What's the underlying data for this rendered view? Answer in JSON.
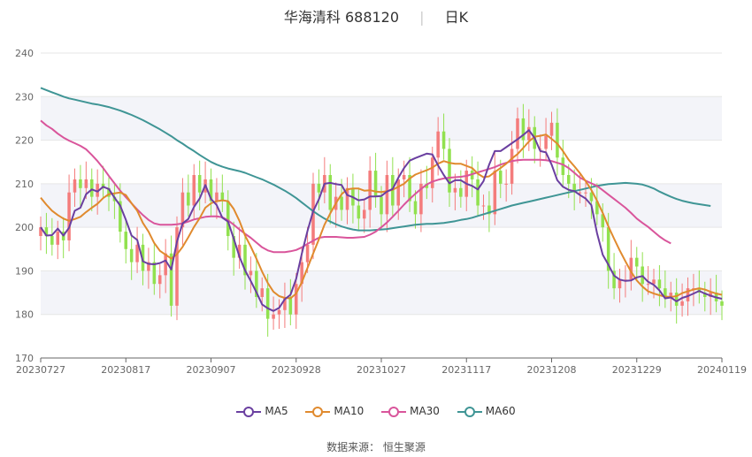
{
  "header": {
    "name_code": "华海清科 688120",
    "period": "日K"
  },
  "source": {
    "label": "数据来源：",
    "provider": "恒生聚源"
  },
  "colors": {
    "up": "#f47c7c",
    "down": "#91e14f",
    "MA5": "#6a3fa0",
    "MA10": "#e08a2e",
    "MA30": "#d9559b",
    "MA60": "#3f9595",
    "band": "#f3f4f9",
    "grid": "#e6e6e6"
  },
  "chart_data": {
    "type": "candlestick",
    "y_axis": {
      "min": 170,
      "max": 240,
      "ticks": [
        "240",
        "230",
        "220",
        "210",
        "200",
        "190",
        "180",
        "170"
      ]
    },
    "x_axis": {
      "labels": [
        "20230727",
        "20230817",
        "20230907",
        "20230928",
        "20231027",
        "20231117",
        "20231208",
        "20231229",
        "20240119"
      ],
      "label_index": [
        0,
        15,
        30,
        45,
        60,
        75,
        90,
        105,
        120
      ]
    },
    "bar_count": 121,
    "close": [
      200,
      198,
      196,
      199,
      197,
      208,
      211,
      209,
      211,
      207,
      210,
      209,
      207,
      206,
      199,
      195,
      192,
      196,
      190,
      192,
      187,
      189,
      194,
      182,
      200,
      208,
      205,
      212,
      208,
      211,
      206,
      208,
      206,
      198,
      193,
      196,
      189,
      190,
      184,
      186,
      179,
      180,
      181,
      184,
      180,
      187,
      192,
      196,
      210,
      208,
      212,
      204,
      207,
      204,
      209,
      205,
      202,
      204,
      213,
      207,
      203,
      212,
      205,
      211,
      212,
      206,
      203,
      210,
      209,
      216,
      222,
      218,
      208,
      209,
      207,
      213,
      211,
      205,
      205,
      203,
      213,
      210,
      210,
      218,
      225,
      220,
      223,
      218,
      218,
      221,
      224,
      216,
      212,
      210,
      208,
      208,
      208,
      206,
      203,
      200,
      190,
      186,
      188,
      188,
      193,
      191,
      187,
      187,
      188,
      186,
      184,
      185,
      182,
      183,
      186,
      186,
      185,
      184,
      185,
      183,
      182
    ],
    "ma5": [
      200.0,
      198.1,
      198.2,
      199.7,
      198.1,
      199.9,
      203.8,
      204.5,
      207.6,
      208.7,
      208.2,
      209.3,
      208.8,
      206.8,
      205.0,
      201.7,
      198.1,
      197.1,
      192.2,
      191.6,
      191.5,
      191.8,
      192.4,
      190.3,
      196.7,
      200.9,
      201.9,
      204.7,
      206.6,
      209.7,
      206.5,
      205.1,
      202.2,
      201.3,
      197.4,
      193.3,
      190.1,
      187.7,
      185.1,
      182.3,
      181.4,
      180.8,
      181.5,
      183.5,
      184.5,
      188.2,
      194.0,
      199.2,
      203.7,
      206.4,
      210.0,
      210.2,
      209.9,
      209.7,
      207.4,
      206.9,
      206.2,
      206.4,
      207.1,
      207.1,
      207.2,
      208.2,
      208.8,
      211.4,
      213.6,
      215.3,
      215.9,
      216.4,
      216.9,
      216.7,
      214.2,
      212.0,
      210.1,
      210.8,
      210.8,
      210.0,
      209.5,
      208.7,
      210.6,
      214.4,
      217.5,
      217.5,
      218.4,
      219.3,
      220.2,
      221.2,
      222.3,
      220.5,
      217.5,
      217.2,
      214.4,
      210.8,
      209.3,
      208.6,
      208.3,
      207.4,
      206.6,
      205.1,
      198.7,
      193.7,
      191.4,
      188.9,
      188.0,
      187.7,
      187.8,
      188.5,
      188.8,
      187.5,
      186.8,
      185.5,
      183.7,
      183.9,
      183.0,
      183.8,
      184.2,
      184.8,
      185.4,
      184.8,
      184.3,
      183.9,
      183.6
    ],
    "ma10": [
      206.8,
      205.2,
      203.8,
      202.8,
      202.0,
      201.5,
      201.9,
      202.4,
      203.5,
      204.5,
      205.4,
      206.7,
      207.6,
      207.8,
      208.0,
      207.4,
      205.5,
      203.8,
      201.0,
      199.0,
      196.4,
      194.6,
      193.7,
      192.8,
      193.8,
      195.5,
      197.7,
      200.1,
      202.1,
      204.5,
      205.5,
      206.0,
      206.2,
      206.0,
      204.2,
      201.5,
      198.1,
      195.6,
      192.8,
      189.8,
      187.2,
      185.2,
      184.2,
      183.8,
      183.7,
      184.8,
      187.4,
      190.7,
      194.0,
      197.2,
      200.6,
      203.2,
      205.5,
      207.6,
      208.7,
      208.9,
      208.9,
      208.4,
      208.5,
      208.2,
      208.1,
      208.3,
      208.6,
      209.3,
      210.0,
      211.2,
      212.1,
      212.6,
      213.1,
      213.7,
      214.6,
      215.2,
      214.8,
      214.6,
      214.6,
      214.1,
      213.6,
      212.3,
      211.5,
      211.7,
      212.7,
      213.6,
      214.6,
      215.8,
      216.8,
      218.2,
      219.7,
      220.8,
      221.0,
      221.3,
      220.3,
      219.2,
      217.5,
      215.5,
      214.0,
      212.4,
      210.6,
      208.6,
      206.1,
      203.3,
      200.2,
      197.4,
      194.7,
      192.2,
      189.8,
      187.8,
      186.4,
      185.3,
      184.8,
      184.4,
      184.1,
      184.0,
      184.2,
      184.9,
      185.3,
      185.7,
      186.0,
      185.7,
      185.2,
      184.8,
      184.5
    ],
    "ma30": [
      224.5,
      223.4,
      222.6,
      221.5,
      220.6,
      219.9,
      219.3,
      218.7,
      217.9,
      216.6,
      215.2,
      213.6,
      211.8,
      210.1,
      208.4,
      206.9,
      205.5,
      204.1,
      202.8,
      201.7,
      200.9,
      200.6,
      200.6,
      200.6,
      200.7,
      200.9,
      201.3,
      201.8,
      202.1,
      202.4,
      202.5,
      202.5,
      202.3,
      201.6,
      200.6,
      199.5,
      198.5,
      197.6,
      196.5,
      195.4,
      194.7,
      194.3,
      194.3,
      194.3,
      194.5,
      194.8,
      195.4,
      196.2,
      196.9,
      197.6,
      197.8,
      197.8,
      197.8,
      197.7,
      197.6,
      197.6,
      197.7,
      197.8,
      198.3,
      199.0,
      200.0,
      201.1,
      202.4,
      203.8,
      205.2,
      206.5,
      207.7,
      208.8,
      209.8,
      210.5,
      210.9,
      211.2,
      211.4,
      211.5,
      211.6,
      211.8,
      212.2,
      212.6,
      213.0,
      213.4,
      213.8,
      214.4,
      214.8,
      215.2,
      215.4,
      215.5,
      215.5,
      215.5,
      215.5,
      215.4,
      215.2,
      214.8,
      214.4,
      213.6,
      212.5,
      211.4,
      210.7,
      210.1,
      209.5,
      208.5,
      207.5,
      206.5,
      205.5,
      204.5,
      203.3,
      202.0,
      201.0,
      200.1,
      199.0,
      197.9,
      197.0,
      196.3
    ],
    "ma60": [
      232.0,
      231.5,
      231.0,
      230.5,
      230.0,
      229.6,
      229.3,
      229.0,
      228.7,
      228.4,
      228.2,
      227.9,
      227.6,
      227.2,
      226.8,
      226.3,
      225.8,
      225.2,
      224.6,
      223.9,
      223.2,
      222.5,
      221.7,
      220.9,
      220.0,
      219.2,
      218.3,
      217.5,
      216.6,
      215.8,
      215.0,
      214.4,
      213.9,
      213.5,
      213.2,
      212.9,
      212.5,
      212.0,
      211.5,
      211.0,
      210.4,
      209.8,
      209.1,
      208.4,
      207.6,
      206.7,
      205.7,
      204.7,
      203.7,
      202.8,
      202.0,
      201.3,
      200.7,
      200.2,
      199.8,
      199.5,
      199.3,
      199.3,
      199.3,
      199.4,
      199.5,
      199.6,
      199.8,
      200.0,
      200.2,
      200.4,
      200.6,
      200.7,
      200.8,
      200.8,
      200.9,
      201.0,
      201.2,
      201.4,
      201.7,
      201.9,
      202.2,
      202.6,
      203.0,
      203.4,
      203.8,
      204.2,
      204.6,
      205.0,
      205.3,
      205.6,
      205.9,
      206.2,
      206.5,
      206.8,
      207.1,
      207.4,
      207.7,
      208.0,
      208.3,
      208.6,
      208.9,
      209.2,
      209.5,
      209.7,
      209.9,
      210.0,
      210.1,
      210.2,
      210.1,
      210.0,
      209.8,
      209.4,
      208.9,
      208.2,
      207.6,
      207.0,
      206.5,
      206.1,
      205.8,
      205.5,
      205.3,
      205.1,
      204.9
    ],
    "series": [
      {
        "name": "MA5",
        "color": "#6a3fa0"
      },
      {
        "name": "MA10",
        "color": "#e08a2e"
      },
      {
        "name": "MA30",
        "color": "#d9559b"
      },
      {
        "name": "MA60",
        "color": "#3f9595"
      }
    ],
    "grid": true,
    "legend": "bottom-center"
  }
}
